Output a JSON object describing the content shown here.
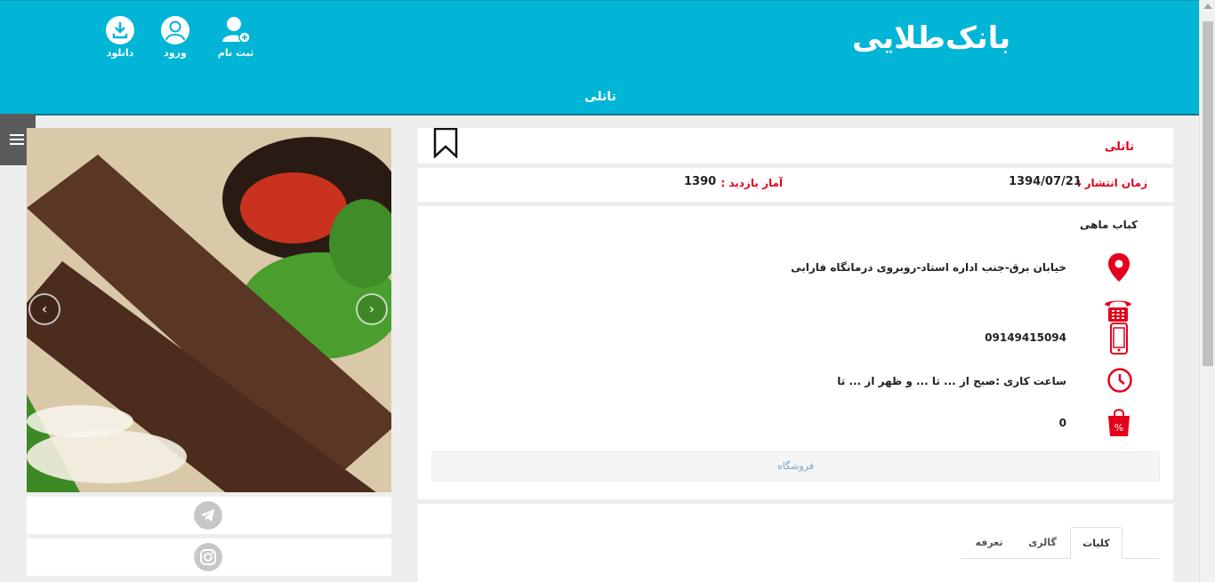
{
  "header": {
    "logo": "بانک‌طلایی",
    "page_title": "تاتلی",
    "buttons": [
      {
        "label": "ثبت نام",
        "icon": "user-add-icon"
      },
      {
        "label": "ورود",
        "icon": "user-icon"
      },
      {
        "label": "دانلود",
        "icon": "download-icon"
      }
    ]
  },
  "listing": {
    "title": "تاتلی",
    "publish_label": "زمان انتشار :",
    "publish_date": "1394/07/21",
    "views_label": "آمار بازدید :",
    "views": "1390",
    "category": "کباب ماهی",
    "address": "خیابان برق-جنب اداره استاد-روبروی درمانگاه فارابی",
    "mobile": "09149415094",
    "hours": "ساعت کاری :صبح از ... تا ... و ظهر از ... تا",
    "discount": "0",
    "shop_button": "فروشگاه"
  },
  "tabs": [
    {
      "label": "کلیات",
      "active": true
    },
    {
      "label": "گالری",
      "active": false
    },
    {
      "label": "تعرفه",
      "active": false
    }
  ],
  "colors": {
    "header_bg": "#01b5d6",
    "accent_red": "#e4001b",
    "social_grey": "#c7c7c7"
  },
  "social": [
    "telegram-icon",
    "instagram-icon"
  ]
}
